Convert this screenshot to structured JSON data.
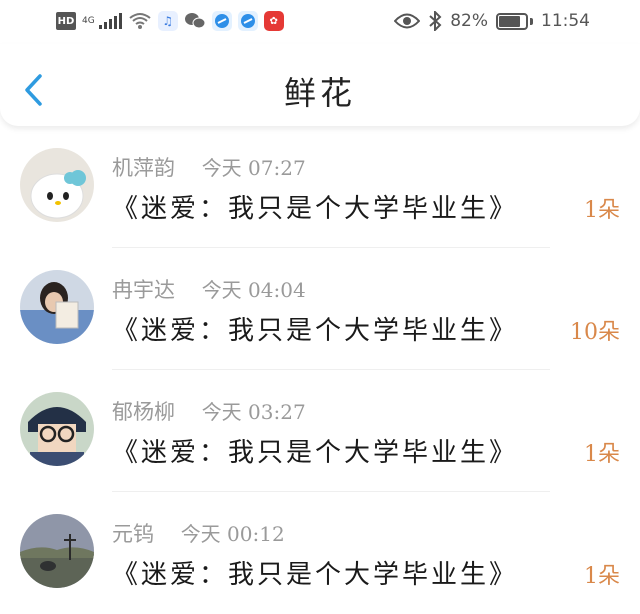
{
  "status_bar": {
    "hd": "HD",
    "network": "4G",
    "battery_percent": "82%",
    "battery_level": 0.82,
    "time": "11:54",
    "icons": [
      "wifi-icon",
      "music-icon",
      "wechat-icon",
      "browser-icon",
      "browser-icon",
      "app-icon",
      "eye-icon",
      "bluetooth-icon",
      "battery-icon"
    ]
  },
  "header": {
    "back_icon": "chevron-left-icon",
    "title": "鲜花"
  },
  "items": [
    {
      "name": "机萍韵",
      "time": "今天 07:27",
      "book": "《迷爱：我只是个大学毕业生》",
      "count": "1朵"
    },
    {
      "name": "冉宇达",
      "time": "今天 04:04",
      "book": "《迷爱：我只是个大学毕业生》",
      "count": "10朵"
    },
    {
      "name": "郁杨柳",
      "time": "今天 03:27",
      "book": "《迷爱：我只是个大学毕业生》",
      "count": "1朵"
    },
    {
      "name": "元钨",
      "time": "今天 00:12",
      "book": "《迷爱：我只是个大学毕业生》",
      "count": "1朵"
    }
  ],
  "colors": {
    "accent_blue": "#2e9be0",
    "count_orange": "#d9884a",
    "meta_gray": "#9a9a9a"
  }
}
